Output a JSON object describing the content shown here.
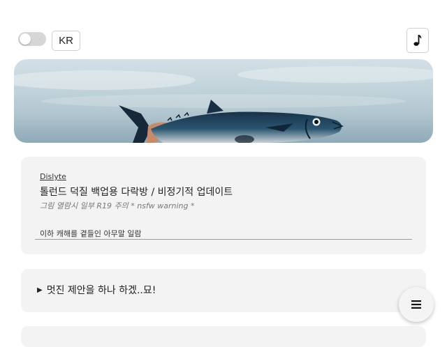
{
  "header": {
    "theme_toggle": {
      "state": "off"
    },
    "language_label": "KR",
    "music_icon": "music-note-icon"
  },
  "banner": {
    "description_icon": "tuna-banner-image",
    "colors": {
      "sky_top": "#cfdde3",
      "sky_bottom": "#9fb8c4",
      "fish_body": "#1f3f55",
      "fish_belly": "#c8d2d6"
    }
  },
  "post": {
    "category": "Dislyte",
    "title": "톨런드 덕질 백업용 다락방 / 비정기적 업데이트",
    "subtitle": "그림 열람시 일부 R19 주의 * nsfw warning *",
    "intro": "이하 캐해를 곁들인 아무말 일람"
  },
  "details": {
    "marker": "▶",
    "summary": "멋진 제안을 하나 하겠..묘!"
  },
  "fab": {
    "icon": "menu-icon"
  },
  "colors": {
    "card_bg": "#f3f3f3",
    "toggle_off": "#d6d6d6",
    "border": "#cfcfcf"
  }
}
